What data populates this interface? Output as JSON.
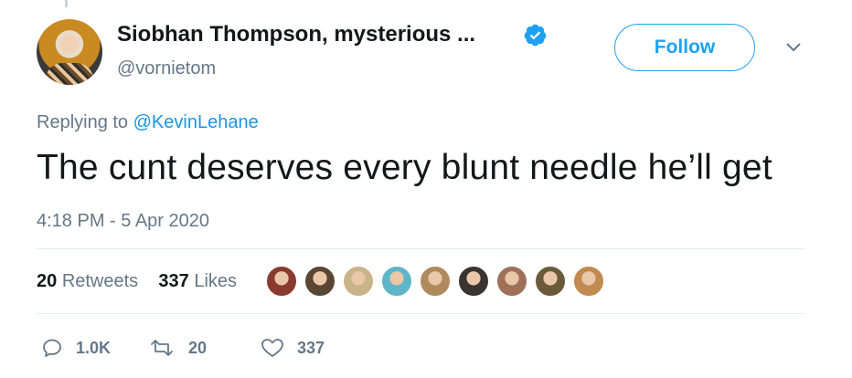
{
  "tweet": {
    "author_name": "Siobhan Thompson, mysterious ...",
    "author_handle": "@vornietom",
    "follow_label": "Follow",
    "reply_prefix": "Replying to ",
    "reply_mention": "@KevinLehane",
    "text": "The cunt deserves every blunt needle he’ll get",
    "timestamp": "4:18 PM - 5 Apr 2020",
    "retweets_count": "20",
    "retweets_label": "Retweets",
    "likes_count": "337",
    "likes_label": "Likes"
  },
  "actions": {
    "reply_count": "1.0K",
    "retweet_count": "20",
    "like_count": "337"
  },
  "likers": [
    {
      "color": "#8a3b2f"
    },
    {
      "color": "#5a4634"
    },
    {
      "color": "#c9b48a"
    },
    {
      "color": "#5fb6c8"
    },
    {
      "color": "#b08a5c"
    },
    {
      "color": "#3a3430"
    },
    {
      "color": "#a0705a"
    },
    {
      "color": "#6a5a3a"
    },
    {
      "color": "#c08a50"
    }
  ],
  "colors": {
    "accent": "#1da1f2",
    "muted_text": "#657786",
    "mention": "#1b95e0"
  }
}
